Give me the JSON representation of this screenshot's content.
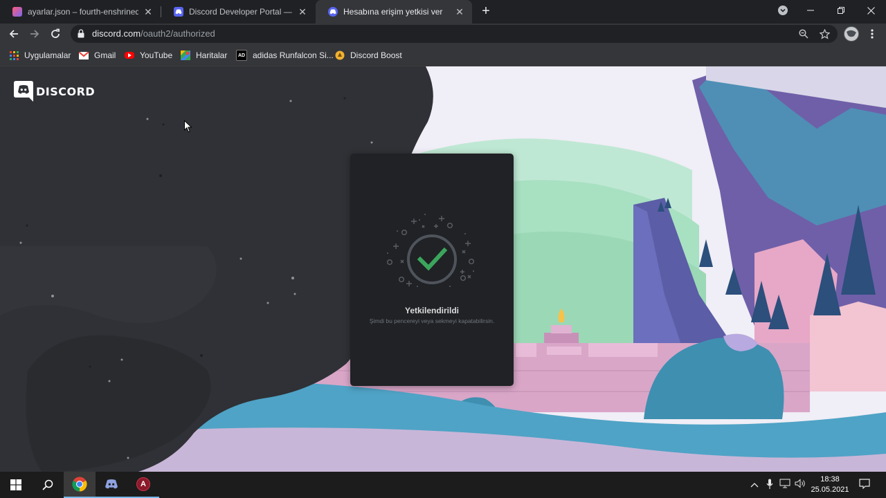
{
  "browser": {
    "tabs": [
      {
        "title": "ayarlar.json – fourth-enshrined-s",
        "favicon": "glitch-icon",
        "active": false
      },
      {
        "title": "Discord Developer Portal — My A",
        "favicon": "discord-icon",
        "active": false
      },
      {
        "title": "Hesabına erişim yetkisi ver",
        "favicon": "discord-icon",
        "active": true
      }
    ],
    "new_tab_label": "+",
    "url_host": "discord.com",
    "url_path": "/oauth2/authorized",
    "bookmarks": [
      {
        "label": "Uygulamalar",
        "icon": "apps-grid-icon"
      },
      {
        "label": "Gmail",
        "icon": "gmail-icon"
      },
      {
        "label": "YouTube",
        "icon": "youtube-icon"
      },
      {
        "label": "Haritalar",
        "icon": "maps-icon"
      },
      {
        "label": "adidas Runfalcon Si...",
        "icon": "adidas-icon",
        "icon_text": "AD"
      },
      {
        "label": "Discord Boost",
        "icon": "boost-icon"
      }
    ]
  },
  "page": {
    "logo_text": "DISCORD",
    "modal": {
      "title": "Yetkilendirildi",
      "subtitle": "Şimdi bu pencereyi veya sekmeyi kapatabilirsin."
    }
  },
  "taskbar": {
    "app_icon_text": "A",
    "time": "18:38",
    "date": "25.05.2021"
  },
  "colors": {
    "discord_blurple": "#5865f2",
    "success_green": "#3ba55c",
    "modal_bg": "#202225",
    "page_dark": "#2f3136"
  }
}
